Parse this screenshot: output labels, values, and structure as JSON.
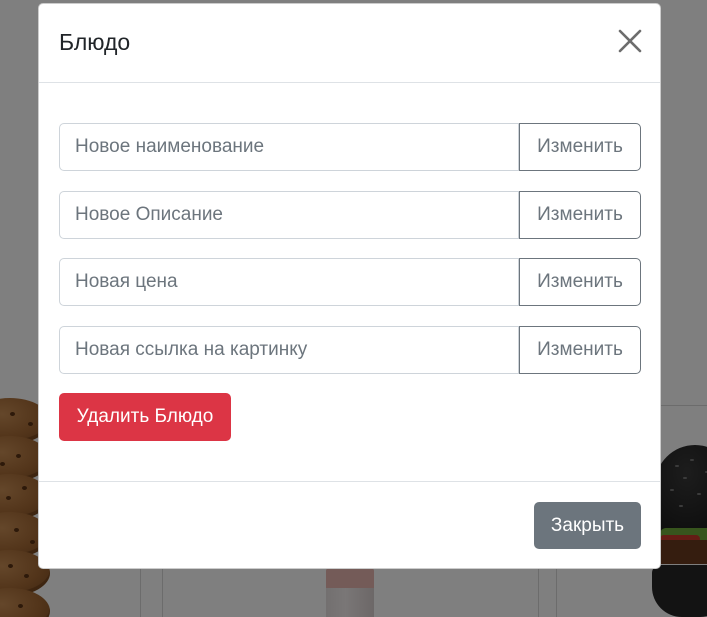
{
  "modal": {
    "title": "Блюдо",
    "fields": [
      {
        "placeholder": "Новое наименование",
        "value": "",
        "button_label": "Изменить"
      },
      {
        "placeholder": "Новое Описание",
        "value": "",
        "button_label": "Изменить"
      },
      {
        "placeholder": "Новая цена",
        "value": "",
        "button_label": "Изменить"
      },
      {
        "placeholder": "Новая ссылка на картинку",
        "value": "",
        "button_label": "Изменить"
      }
    ],
    "delete_label": "Удалить Блюдо",
    "footer": {
      "close_label": "Закрыть"
    }
  },
  "icons": {
    "close": "close-icon"
  },
  "colors": {
    "danger": "#dc3545",
    "secondary": "#6c757d",
    "backdrop": "rgba(0,0,0,0.5)"
  },
  "background": {
    "images": [
      "cookies",
      "drink-glass",
      "black-bun-burger"
    ]
  }
}
